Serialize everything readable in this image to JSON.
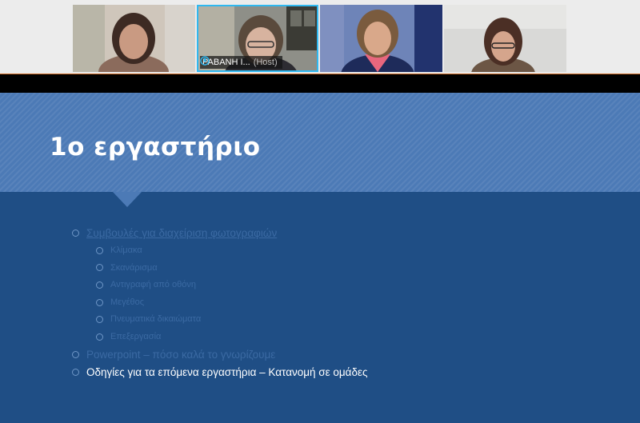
{
  "participants": [
    {
      "id": "p1",
      "name": "",
      "host": ""
    },
    {
      "id": "p2",
      "name": "ΡΑΒΑΝΗ Ι...",
      "host": "(Host)"
    },
    {
      "id": "p3",
      "name": "",
      "host": ""
    },
    {
      "id": "p4",
      "name": "",
      "host": ""
    }
  ],
  "slide": {
    "title": "1ο εργαστήριο",
    "bullets": [
      {
        "text": "Συμβουλές για διαχείριση φωτογραφιών",
        "level": 1,
        "style": "faint-link"
      },
      {
        "text": "Κλίμακα",
        "level": 2,
        "style": "faint"
      },
      {
        "text": "Σκανάρισμα",
        "level": 2,
        "style": "faint"
      },
      {
        "text": "Αντιγραφή από οθόνη",
        "level": 2,
        "style": "faint"
      },
      {
        "text": "Μεγέθος",
        "level": 2,
        "style": "faint"
      },
      {
        "text": "Πνευματικά δικαιώματα",
        "level": 2,
        "style": "faint"
      },
      {
        "text": "Επεξεργασία",
        "level": 2,
        "style": "faint"
      },
      {
        "text": "Powerpoint – πόσο καλά το γνωρίζουμε",
        "level": 1,
        "style": "faint"
      },
      {
        "text": "Οδηγίες για τα επόμενα εργαστήρια – Κατανομή σε ομάδες",
        "level": 1,
        "style": "normal"
      }
    ]
  },
  "colors": {
    "slide_bg": "#1f4e85",
    "header_bg": "#4c7ab6",
    "active_speaker": "#2fb8f0"
  }
}
